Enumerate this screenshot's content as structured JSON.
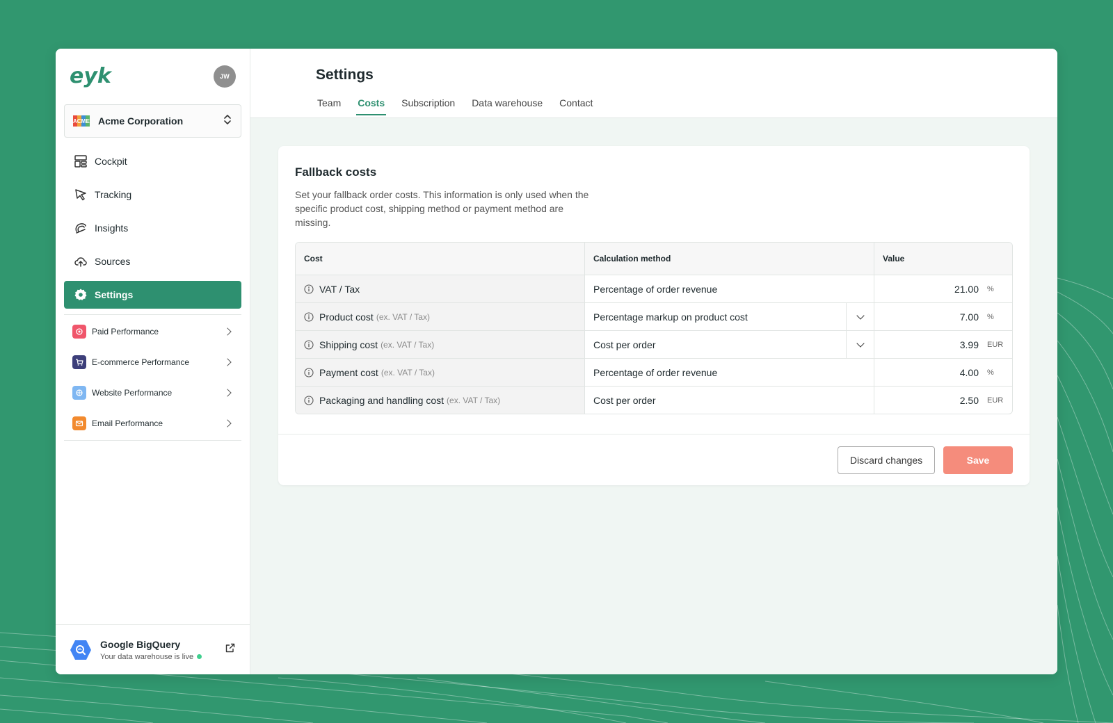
{
  "user": {
    "initials": "JW"
  },
  "organization": {
    "name": "Acme Corporation"
  },
  "nav": {
    "items": [
      {
        "label": "Cockpit",
        "icon": "layout-icon"
      },
      {
        "label": "Tracking",
        "icon": "cursor-icon"
      },
      {
        "label": "Insights",
        "icon": "insights-icon"
      },
      {
        "label": "Sources",
        "icon": "cloud-upload-icon"
      },
      {
        "label": "Settings",
        "icon": "gear-icon",
        "active": true
      }
    ],
    "sub_items": [
      {
        "label": "Paid Performance",
        "color": "#f0566b"
      },
      {
        "label": "E-commerce Performance",
        "color": "#3d3f7a"
      },
      {
        "label": "Website Performance",
        "color": "#7fb7f2"
      },
      {
        "label": "Email Performance",
        "color": "#f28a2e"
      }
    ]
  },
  "warehouse": {
    "name": "Google BigQuery",
    "status": "Your data warehouse is live"
  },
  "page": {
    "title": "Settings",
    "tabs": [
      {
        "label": "Team"
      },
      {
        "label": "Costs",
        "active": true
      },
      {
        "label": "Subscription"
      },
      {
        "label": "Data warehouse"
      },
      {
        "label": "Contact"
      }
    ]
  },
  "card": {
    "title": "Fallback costs",
    "description": "Set your fallback order costs. This information is only used when the specific product cost, shipping method or payment method are missing.",
    "columns": {
      "cost": "Cost",
      "method": "Calculation method",
      "value": "Value"
    },
    "rows": [
      {
        "cost": "VAT / Tax",
        "note": "",
        "method": "Percentage of order revenue",
        "dropdown": false,
        "value": "21.00",
        "unit": "%"
      },
      {
        "cost": "Product cost",
        "note": "(ex. VAT / Tax)",
        "method": "Percentage markup on product cost",
        "dropdown": true,
        "value": "7.00",
        "unit": "%"
      },
      {
        "cost": "Shipping cost",
        "note": "(ex. VAT / Tax)",
        "method": "Cost per order",
        "dropdown": true,
        "value": "3.99",
        "unit": "EUR"
      },
      {
        "cost": "Payment cost",
        "note": "(ex. VAT / Tax)",
        "method": "Percentage of order revenue",
        "dropdown": false,
        "value": "4.00",
        "unit": "%"
      },
      {
        "cost": "Packaging and handling cost",
        "note": "(ex. VAT / Tax)",
        "method": "Cost per order",
        "dropdown": false,
        "value": "2.50",
        "unit": "EUR"
      }
    ],
    "discard_label": "Discard changes",
    "save_label": "Save"
  },
  "colors": {
    "brand": "#2e9070",
    "background": "#31976f",
    "save": "#f58c7c",
    "live": "#3fcf8e"
  }
}
